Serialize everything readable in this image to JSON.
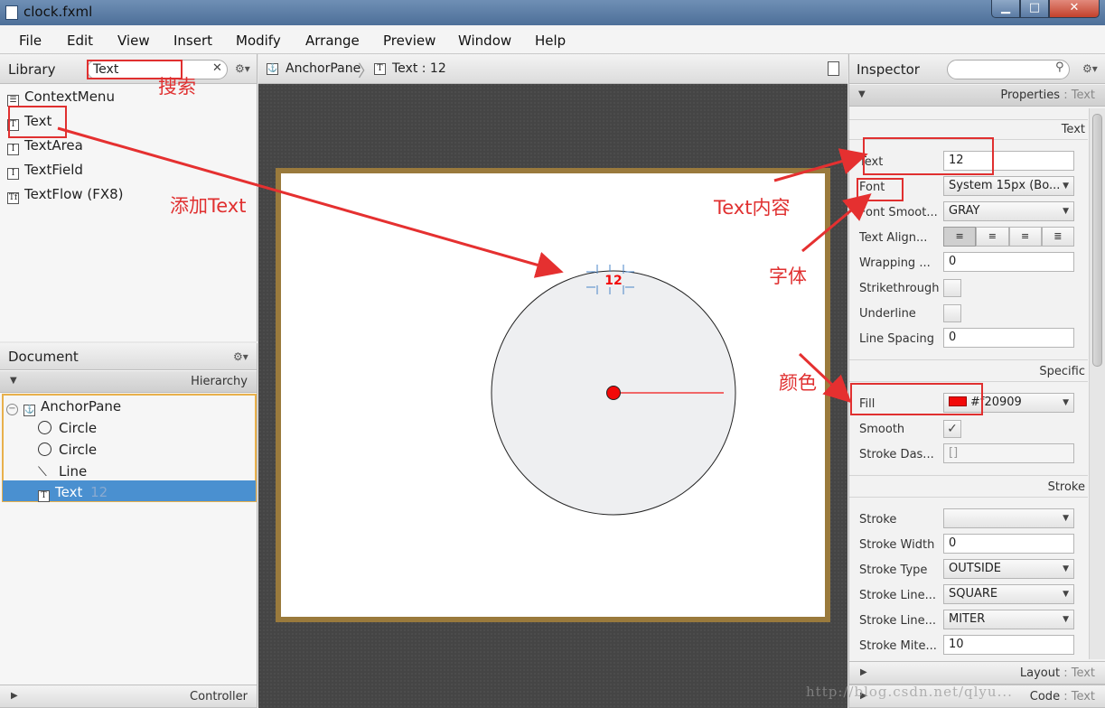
{
  "window": {
    "title": "clock.fxml",
    "minimize": "▁",
    "maximize": "□",
    "close": "✕"
  },
  "menu": [
    "File",
    "Edit",
    "View",
    "Insert",
    "Modify",
    "Arrange",
    "Preview",
    "Window",
    "Help"
  ],
  "library": {
    "title": "Library",
    "search_value": "Text",
    "clear": "✕",
    "gear": "⚙▾",
    "items": [
      {
        "icon": "context-menu-icon",
        "label": "ContextMenu"
      },
      {
        "icon": "text-icon",
        "label": "Text"
      },
      {
        "icon": "text-area-icon",
        "label": "TextArea"
      },
      {
        "icon": "text-field-icon",
        "label": "TextField"
      },
      {
        "icon": "text-flow-icon",
        "label": "TextFlow  (FX8)"
      }
    ]
  },
  "document": {
    "title": "Document",
    "gear": "⚙▾",
    "hierarchy": "Hierarchy",
    "tree": [
      {
        "icon": "anchor-pane-icon",
        "label": "AnchorPane"
      },
      {
        "icon": "circle-icon",
        "label": "Circle"
      },
      {
        "icon": "circle-icon",
        "label": "Circle"
      },
      {
        "icon": "line-icon",
        "label": "Line"
      },
      {
        "icon": "text-icon",
        "label": "Text",
        "extra": "12"
      }
    ],
    "controller": "Controller"
  },
  "breadcrumb": {
    "root": "AnchorPane",
    "current": "Text : 12"
  },
  "canvas": {
    "text_value": "12",
    "fill_color": "#f20909"
  },
  "inspector": {
    "title": "Inspector",
    "gear": "⚙▾",
    "properties_header": "Properties",
    "properties_target": " : Text",
    "sections": {
      "text": {
        "title": "Text",
        "rows": [
          {
            "label": "Text",
            "value": "12",
            "kind": "field"
          },
          {
            "label": "Font",
            "value": "System 15px (Bo...",
            "kind": "combo"
          },
          {
            "label": "Font Smoot...",
            "value": "GRAY",
            "kind": "combo"
          },
          {
            "label": "Text Align...",
            "value": "",
            "kind": "align"
          },
          {
            "label": "Wrapping ...",
            "value": "0",
            "kind": "field"
          },
          {
            "label": "Strikethrough",
            "value": "",
            "kind": "check"
          },
          {
            "label": "Underline",
            "value": "",
            "kind": "check"
          },
          {
            "label": "Line Spacing",
            "value": "0",
            "kind": "field"
          }
        ]
      },
      "specific": {
        "title": "Specific",
        "fill_label": "Fill",
        "fill_value": "#f20909",
        "smooth_label": "Smooth",
        "smooth_check": "✓",
        "stroke_dash_label": "Stroke Das...",
        "stroke_dash_value": "[]"
      },
      "stroke": {
        "title": "Stroke",
        "rows": [
          {
            "label": "Stroke",
            "value": "",
            "kind": "combo"
          },
          {
            "label": "Stroke Width",
            "value": "0",
            "kind": "field"
          },
          {
            "label": "Stroke Type",
            "value": "OUTSIDE",
            "kind": "combo"
          },
          {
            "label": "Stroke Line...",
            "value": "SQUARE",
            "kind": "combo"
          },
          {
            "label": "Stroke Line...",
            "value": "MITER",
            "kind": "combo"
          },
          {
            "label": "Stroke Mite...",
            "value": "10",
            "kind": "field"
          }
        ]
      }
    },
    "layout_header": "Layout",
    "layout_target": " : Text",
    "code_header": "Code",
    "code_target": " : Text"
  },
  "annotations": {
    "search": "搜索",
    "add_text": "添加Text",
    "text_content": "Text内容",
    "font": "字体",
    "color": "颜色"
  },
  "watermark": "http://blog.csdn.net/qlyu..."
}
